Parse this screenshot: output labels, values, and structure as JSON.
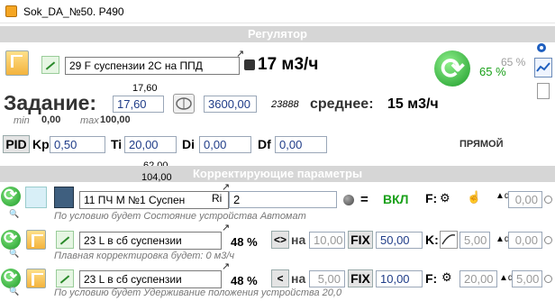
{
  "window": {
    "title": "Sok_DA_№50. P490"
  },
  "regulator": {
    "section_title": "Регулятор",
    "source_select": "29 F суспензии 2С на ППД",
    "flow_value": "17 м3/ч",
    "percent": "65 %",
    "percent_faded": "65 %",
    "setpoint_label": "Задание:",
    "setpoint_top": "17,60",
    "setpoint_value": "17,60",
    "min_label": "min",
    "min_value": "0,00",
    "max_label": "max",
    "max_value": "100,00",
    "time_value": "3600,00",
    "counter": "23888",
    "average_label": "среднее:",
    "average_value": "15 м3/ч",
    "pid": {
      "button": "PID",
      "kp_label": "Kp",
      "kp_value": "0,50",
      "ti_label": "Ti",
      "ti_value": "20,00",
      "di_label": "Di",
      "di_value": "0,00",
      "df_label": "Df",
      "df_value": "0,00",
      "mode": "ПРЯМОЙ"
    }
  },
  "correcting": {
    "section_title": "Корректирующие параметры",
    "top_value_1": "62,00",
    "top_value_2": "104,00",
    "row1": {
      "select": "11 ПЧ М №1 Суспен",
      "ri_label": "Ri",
      "ri_value": "2",
      "eq": "=",
      "state": "ВКЛ",
      "f_label": "F:",
      "value": "0,00",
      "note": "По условию будет Состояние устройства Автомат"
    },
    "row2": {
      "select": "23 L в сб суспензии",
      "percent": "48 %",
      "op": "<>",
      "na_label": "на",
      "na_value": "10,00",
      "fix_label": "FIX",
      "fix_value": "50,00",
      "k_label": "K:",
      "value1": "5,00",
      "value2": "0,00",
      "note": "Плавная корректировка будет: 0 м3/ч"
    },
    "row3": {
      "select": "23 L в сб суспензии",
      "percent": "48 %",
      "op": "<",
      "na_label": "на",
      "na_value": "5,00",
      "fix_label": "FIX",
      "fix_value": "10,00",
      "f_label": "F:",
      "value1": "20,00",
      "value2": "5,00",
      "note": "По условию будет Удерживание положения устройства 20,0"
    }
  },
  "colors": {
    "section_bg": "#d6d6d6",
    "state_on": "#19a019",
    "field_text": "#1f3c88"
  }
}
